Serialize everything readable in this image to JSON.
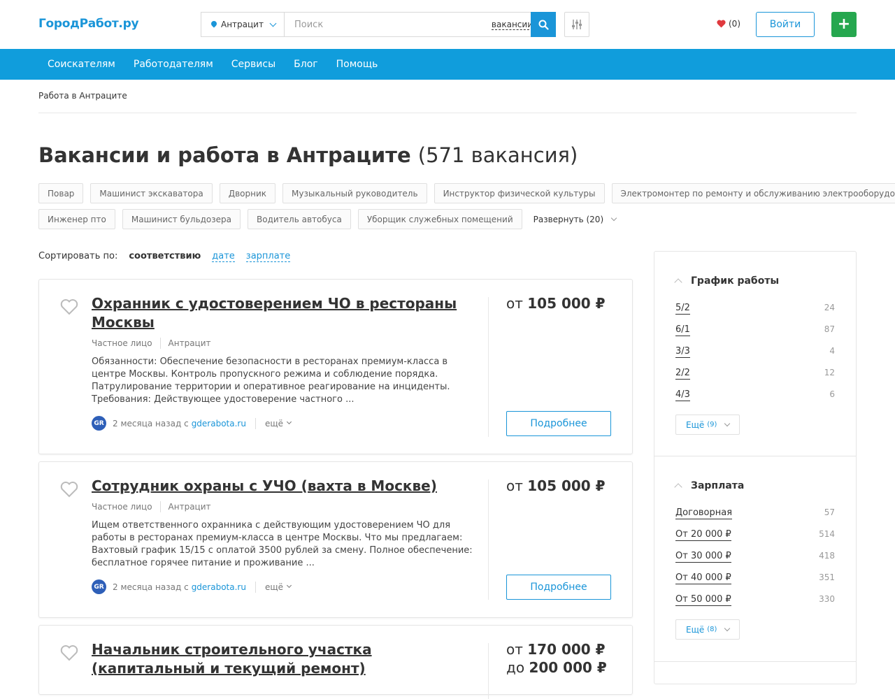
{
  "header": {
    "logo": "ГородРабот.ру",
    "city": "Антрацит",
    "search_placeholder": "Поиск",
    "scope": "вакансии",
    "favorites": "(0)",
    "login": "Войти",
    "add": "+"
  },
  "nav": [
    "Соискателям",
    "Работодателям",
    "Сервисы",
    "Блог",
    "Помощь"
  ],
  "breadcrumb": "Работа в Антраците",
  "title": "Вакансии и работа в Антраците",
  "title_count": "(571 вакансия)",
  "tags_row1": [
    "Повар",
    "Машинист экскаватора",
    "Дворник",
    "Музыкальный руководитель",
    "Инструктор физической культуры",
    "Электромонтер по ремонту и обслуживанию электрооборудования"
  ],
  "tags_row2": [
    "Инженер пто",
    "Машинист бульдозера",
    "Водитель автобуса",
    "Уборщик служебных помещений"
  ],
  "expand": "Развернуть (20)",
  "sort": {
    "label": "Сортировать по:",
    "active": "соответствию",
    "options": [
      "дате",
      "зарплате"
    ]
  },
  "jobs": [
    {
      "title": "Охранник с удостоверением ЧО в рестораны Москвы",
      "employer": "Частное лицо",
      "city": "Антрацит",
      "description": "Обязанности: Обеспечение безопасности в ресторанах премиум-класса в центре Москвы. Контроль пропускного режима и соблюдение порядка. Патрулирование территории и оперативное реагирование на инциденты. Требования: Действующее удостоверение частного ...",
      "avatar": "GR",
      "posted": "2 месяца назад с",
      "site": "gderabota.ru",
      "more": "ещё",
      "salary_prefix": "от",
      "salary": "105 000 ₽",
      "details": "Подробнее"
    },
    {
      "title": "Сотрудник охраны с УЧО (вахта в Москве)",
      "employer": "Частное лицо",
      "city": "Антрацит",
      "description": "Ищем ответственного охранника с действующим удостоверением ЧО для работы в ресторанах премиум-класса в центре Москвы. Что мы предлагаем: Вахтовый график 15/15 с оплатой 3500 рублей за смену. Полное обеспечение: бесплатное горячее питание и проживание ...",
      "avatar": "GR",
      "posted": "2 месяца назад с",
      "site": "gderabota.ru",
      "more": "ещё",
      "salary_prefix": "от",
      "salary": "105 000 ₽",
      "details": "Подробнее"
    },
    {
      "title": "Начальник строительного участка (капитальный и текущий ремонт)",
      "salary_prefix": "от",
      "salary": "170 000 ₽",
      "salary2_prefix": "до",
      "salary2": "200 000 ₽"
    }
  ],
  "sidebar": {
    "schedule": {
      "title": "График работы",
      "items": [
        {
          "label": "5/2",
          "count": "24"
        },
        {
          "label": "6/1",
          "count": "87"
        },
        {
          "label": "3/3",
          "count": "4"
        },
        {
          "label": "2/2",
          "count": "12"
        },
        {
          "label": "4/3",
          "count": "6"
        }
      ],
      "more": "Ещё",
      "more_count": "(9)"
    },
    "salary": {
      "title": "Зарплата",
      "items": [
        {
          "label": "Договорная",
          "count": "57"
        },
        {
          "label": "От 20 000 ₽",
          "count": "514"
        },
        {
          "label": "От 30 000 ₽",
          "count": "418"
        },
        {
          "label": "От 40 000 ₽",
          "count": "351"
        },
        {
          "label": "От 50 000 ₽",
          "count": "330"
        }
      ],
      "more": "Ещё",
      "more_count": "(8)"
    }
  },
  "colors": {
    "brand": "#1a95d8",
    "nav": "#109ddc",
    "add": "#26a74f",
    "heart": "#e0393e"
  }
}
